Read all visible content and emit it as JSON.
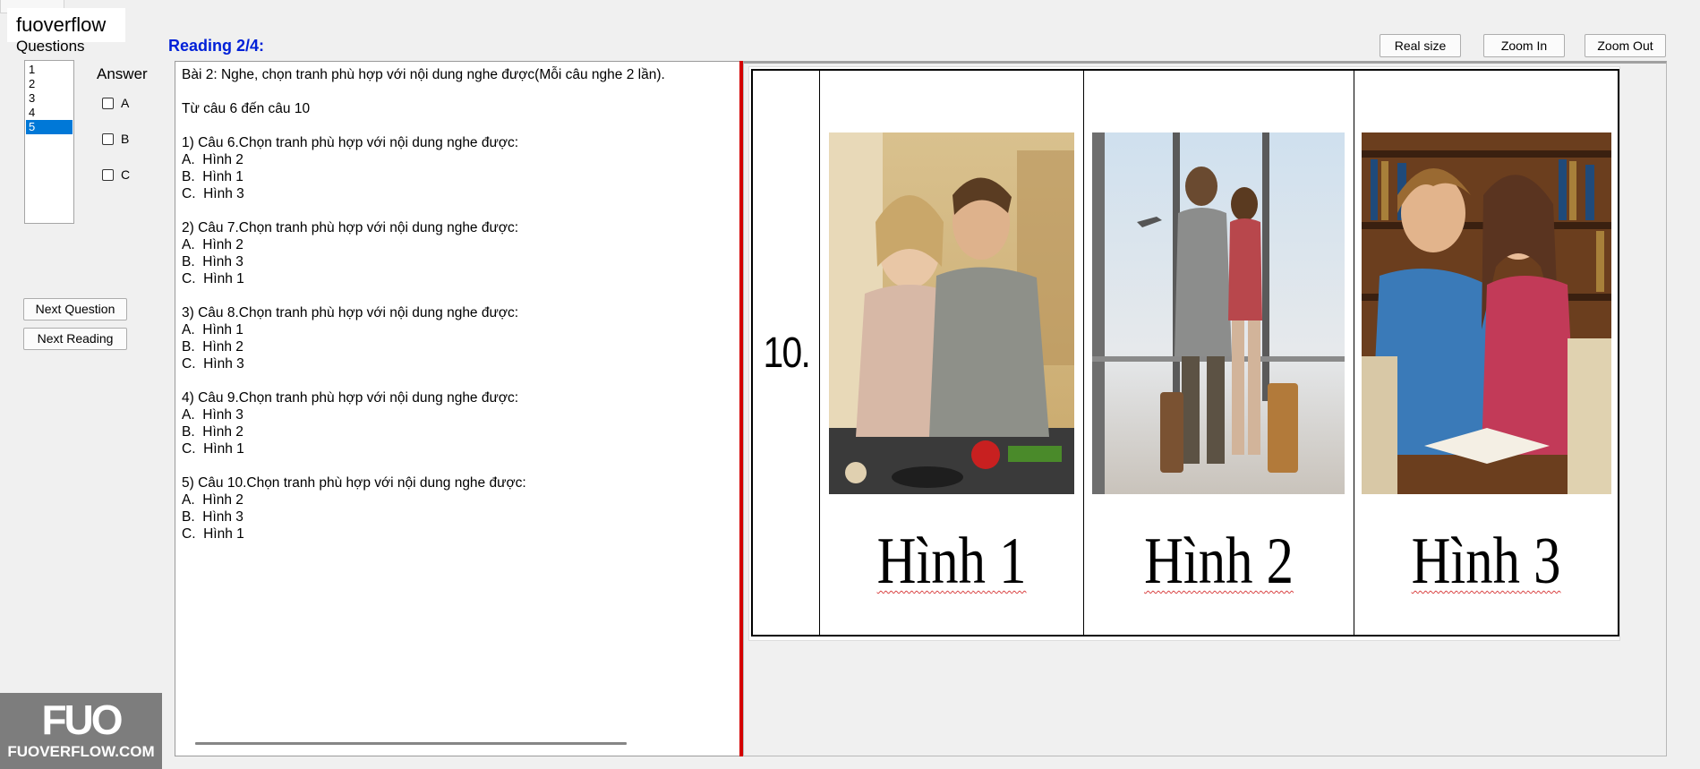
{
  "watermark_top": "fuoverflow",
  "questions_label": "Questions",
  "question_list": [
    "1",
    "2",
    "3",
    "4",
    "5"
  ],
  "selected_question_index": 4,
  "answer_label": "Answer",
  "answer_options": [
    "A",
    "B",
    "C"
  ],
  "next_question_label": "Next Question",
  "next_reading_label": "Next Reading",
  "reading_title": "Reading 2/4:",
  "reading_lines": [
    "Bài 2: Nghe, chọn tranh phù hợp với nội dung nghe được(Mỗi câu nghe 2 lần).",
    "",
    "Từ câu 6 đến câu 10",
    "",
    "1) Câu 6.Chọn tranh phù hợp với nội dung nghe được:",
    "A.  Hình 2",
    "B.  Hình 1",
    "C.  Hình 3",
    "",
    "2) Câu 7.Chọn tranh phù hợp với nội dung nghe được:",
    "A.  Hình 2",
    "B.  Hình 3",
    "C.  Hình 1",
    "",
    "3) Câu 8.Chọn tranh phù hợp với nội dung nghe được:",
    "A.  Hình 1",
    "B.  Hình 2",
    "C.  Hình 3",
    "",
    "4) Câu 9.Chọn tranh phù hợp với nội dung nghe được:",
    "A.  Hình 3",
    "B.  Hình 2",
    "C.  Hình 1",
    "",
    "5) Câu 10.Chọn tranh phù hợp với nội dung nghe được:",
    "A.  Hình 2",
    "B.  Hình 3",
    "C.  Hình 1"
  ],
  "zoom_buttons": {
    "real": "Real size",
    "zin": "Zoom In",
    "zout": "Zoom Out"
  },
  "image": {
    "number": "10.",
    "captions": [
      "Hình 1",
      "Hình 2",
      "Hình 3"
    ]
  },
  "logo": {
    "mark": "FUO",
    "text": "FUOVERFLOW.COM"
  },
  "colors": {
    "accent_blue": "#0020d8",
    "splitter_red": "#d40000",
    "selection": "#0078d7"
  }
}
